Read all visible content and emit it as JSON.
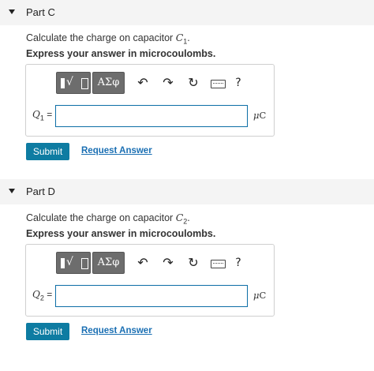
{
  "parts": [
    {
      "title": "Part C",
      "prompt_text": "Calculate the charge on capacitor ",
      "prompt_var": "C",
      "prompt_sub": "1",
      "prompt_end": ".",
      "instruction": "Express your answer in microcoulombs.",
      "var_label": "Q",
      "var_sub": "1",
      "equals": " =",
      "input_value": "",
      "unit_mu": "μ",
      "unit_c": "C",
      "submit_label": "Submit",
      "request_label": "Request Answer"
    },
    {
      "title": "Part D",
      "prompt_text": "Calculate the charge on capacitor ",
      "prompt_var": "C",
      "prompt_sub": "2",
      "prompt_end": ".",
      "instruction": "Express your answer in microcoulombs.",
      "var_label": "Q",
      "var_sub": "2",
      "equals": " =",
      "input_value": "",
      "unit_mu": "μ",
      "unit_c": "C",
      "submit_label": "Submit",
      "request_label": "Request Answer"
    }
  ],
  "toolbar": {
    "sqrt_symbol": "√",
    "greek_label": "ΑΣφ",
    "undo_icon": "↶",
    "redo_icon": "↷",
    "reset_icon": "↻",
    "help_label": "?"
  }
}
